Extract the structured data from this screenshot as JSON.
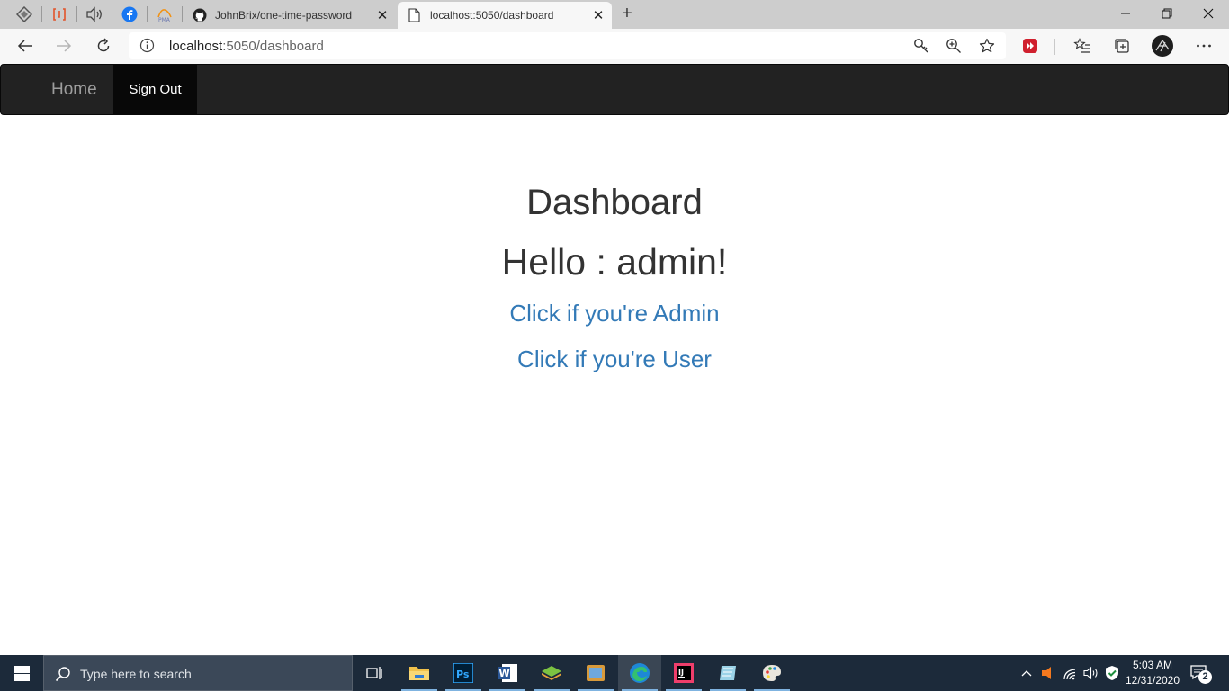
{
  "browser": {
    "tabs": [
      {
        "title": "JohnBrix/one-time-password",
        "active": false
      },
      {
        "title": "localhost:5050/dashboard",
        "active": true
      }
    ],
    "address": {
      "host": "localhost",
      "path": ":5050/dashboard"
    }
  },
  "navbar": {
    "brand": "Home",
    "links": [
      {
        "label": "Sign Out"
      }
    ]
  },
  "main": {
    "title": "Dashboard",
    "greeting": "Hello : admin!",
    "links": [
      {
        "label": "Click if you're Admin"
      },
      {
        "label": "Click if you're User"
      }
    ]
  },
  "taskbar": {
    "search_placeholder": "Type here to search",
    "time": "5:03 AM",
    "date": "12/31/2020",
    "notification_count": "2"
  },
  "colors": {
    "navbar_bg": "#222222",
    "active_nav": "#080808",
    "link": "#337ab7",
    "taskbar": "#1c2a3a"
  }
}
